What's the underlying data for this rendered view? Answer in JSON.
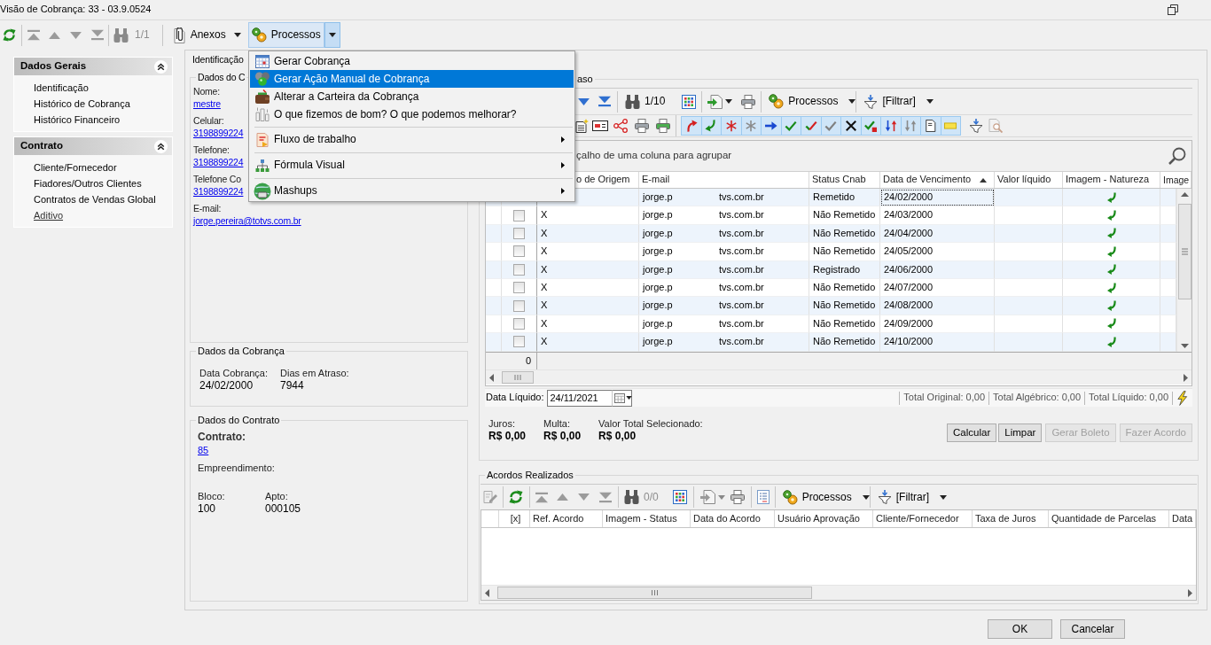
{
  "window": {
    "title": "Visão de Cobrança: 33 - 03.9.0524"
  },
  "toolbar": {
    "nav_disabled": true,
    "counter": "1/1",
    "attachments": {
      "label": "Anexos"
    },
    "processes": {
      "label": "Processos",
      "pressed": true
    }
  },
  "menu": {
    "items": [
      {
        "kind": "item",
        "label": "Gerar Cobrança",
        "selected": false
      },
      {
        "kind": "item",
        "label": "Gerar Ação Manual de Cobrança",
        "selected": true
      },
      {
        "kind": "item",
        "label": "Alterar a Carteira da Cobrança",
        "selected": false
      },
      {
        "kind": "item",
        "label": "O que fizemos de bom? O que podemos melhorar?",
        "selected": false
      },
      {
        "kind": "separator"
      },
      {
        "kind": "submenu",
        "label": "Fluxo de trabalho",
        "selected": false
      },
      {
        "kind": "separator"
      },
      {
        "kind": "submenu",
        "label": "Fórmula Visual",
        "selected": false
      },
      {
        "kind": "separator"
      },
      {
        "kind": "submenu",
        "label": "Mashups",
        "selected": false
      }
    ]
  },
  "sidebar": {
    "sections": [
      {
        "title": "Dados Gerais",
        "items": [
          {
            "label": "Identificação",
            "hovered": false
          },
          {
            "label": "Histórico de Cobrança",
            "hovered": false
          },
          {
            "label": "Histórico Financeiro",
            "hovered": false
          }
        ]
      },
      {
        "title": "Contrato",
        "items": [
          {
            "label": "Cliente/Fornecedor",
            "hovered": false
          },
          {
            "label": "Fiadores/Outros Clientes",
            "hovered": false
          },
          {
            "label": "Contratos de Vendas Global",
            "hovered": false
          },
          {
            "label": "Aditivo",
            "hovered": true
          }
        ]
      }
    ]
  },
  "details": {
    "title": "Identificação",
    "contact": {
      "title": "Dados do C",
      "fields": [
        {
          "label": "Nome:",
          "value": "mestre"
        },
        {
          "label": "Celular:",
          "value": "3198899224"
        },
        {
          "label": "Telefone:",
          "value": "3198899224"
        },
        {
          "label": "Telefone Co",
          "value": "3198899224"
        },
        {
          "label": "E-mail:",
          "value": "jorge.pereira@totvs.com.br"
        }
      ]
    },
    "billing": {
      "title": "Dados da Cobrança",
      "fields": [
        {
          "label": "Data Cobrança:",
          "value": "24/02/2000"
        },
        {
          "label": "Dias em Atraso:",
          "value": "7944"
        }
      ]
    },
    "contract": {
      "title": "Dados do Contrato",
      "number_label": "Contrato:",
      "number": "85",
      "development_label": "Empreendimento:",
      "fields": [
        {
          "label": "Bloco:",
          "value": "100"
        },
        {
          "label": "Apto:",
          "value": "000105"
        }
      ]
    }
  },
  "installments": {
    "title": "aso",
    "toolbar": {
      "nav_disabled": false,
      "counter": "1/10",
      "processes": {
        "label": "Processos",
        "pressed": false
      },
      "filter": "[Filtrar]",
      "toggles": [
        {
          "on": true
        },
        {
          "on": true
        },
        {
          "on": true
        },
        {
          "on": true
        },
        {
          "on": true
        },
        {
          "on": true
        },
        {
          "on": true
        },
        {
          "on": true
        },
        {
          "on": true
        },
        {
          "on": true
        },
        {
          "on": true
        },
        {
          "on": true
        },
        {
          "on": true
        },
        {
          "on": true
        }
      ]
    },
    "group_hint": "çalho de uma coluna para agrupar",
    "columns": [
      {
        "label": "o de Origem",
        "sorted": false
      },
      {
        "label": "E-mail",
        "sorted": false
      },
      {
        "label": "Status Cnab",
        "sorted": false
      },
      {
        "label": "Data de Vencimento",
        "sorted": true
      },
      {
        "label": "Valor líquido",
        "sorted": false
      },
      {
        "label": "Imagem - Natureza",
        "sorted": false
      },
      {
        "label": "Image",
        "sorted": false
      }
    ],
    "rows": [
      {
        "email": [
          "jorge.p",
          "tvs.com.br"
        ],
        "status": "Remetido",
        "due_date": "24/02/2000",
        "selected": true
      },
      {
        "checked": false,
        "origin": "X",
        "email": [
          "jorge.p",
          "tvs.com.br"
        ],
        "status": "Não Remetido",
        "due_date": "24/03/2000",
        "selected": false
      },
      {
        "checked": false,
        "origin": "X",
        "email": [
          "jorge.p",
          "tvs.com.br"
        ],
        "status": "Não Remetido",
        "due_date": "24/04/2000",
        "selected": false
      },
      {
        "checked": false,
        "origin": "X",
        "email": [
          "jorge.p",
          "tvs.com.br"
        ],
        "status": "Não Remetido",
        "due_date": "24/05/2000",
        "selected": false
      },
      {
        "checked": false,
        "origin": "X",
        "email": [
          "jorge.p",
          "tvs.com.br"
        ],
        "status": "Registrado",
        "due_date": "24/06/2000",
        "selected": false
      },
      {
        "checked": false,
        "origin": "X",
        "email": [
          "jorge.p",
          "tvs.com.br"
        ],
        "status": "Não Remetido",
        "due_date": "24/07/2000",
        "selected": false
      },
      {
        "checked": false,
        "origin": "X",
        "email": [
          "jorge.p",
          "tvs.com.br"
        ],
        "status": "Não Remetido",
        "due_date": "24/08/2000",
        "selected": false
      },
      {
        "checked": false,
        "origin": "X",
        "email": [
          "jorge.p",
          "tvs.com.br"
        ],
        "status": "Não Remetido",
        "due_date": "24/09/2000",
        "selected": false
      },
      {
        "checked": false,
        "origin": "X",
        "email": [
          "jorge.p",
          "tvs.com.br"
        ],
        "status": "Não Remetido",
        "due_date": "24/10/2000",
        "selected": false
      }
    ],
    "footer_count": "0",
    "net_date": {
      "label": "Data Líquido:",
      "value": "24/11/2021"
    },
    "totals": [
      "Total Original: 0,00",
      "Total Algébrico: 0,00",
      "Total Líquido: 0,00"
    ],
    "amounts": [
      {
        "label": "Juros:",
        "value": "R$ 0,00"
      },
      {
        "label": "Multa:",
        "value": "R$ 0,00"
      },
      {
        "label": "Valor Total Selecionado:",
        "value": "R$ 0,00"
      }
    ],
    "buttons": [
      {
        "label": "Calcular",
        "disabled": false
      },
      {
        "label": "Limpar",
        "disabled": false
      },
      {
        "label": "Gerar Boleto",
        "disabled": true
      },
      {
        "label": "Fazer Acordo",
        "disabled": true
      }
    ]
  },
  "agreements": {
    "title": "Acordos Realizados",
    "toolbar": {
      "nav_disabled": true,
      "counter": "0/0",
      "processes": {
        "label": "Processos",
        "pressed": false
      },
      "filter": "[Filtrar]"
    },
    "columns": [
      {
        "label": "[x]"
      },
      {
        "label": "Ref. Acordo"
      },
      {
        "label": "Imagem - Status"
      },
      {
        "label": "Data do Acordo"
      },
      {
        "label": "Usuário Aprovação"
      },
      {
        "label": "Cliente/Fornecedor"
      },
      {
        "label": "Taxa de Juros"
      },
      {
        "label": "Quantidade de Parcelas"
      },
      {
        "label": "Data"
      }
    ]
  },
  "dialog_buttons": [
    {
      "label": "OK"
    },
    {
      "label": "Cancelar"
    }
  ]
}
